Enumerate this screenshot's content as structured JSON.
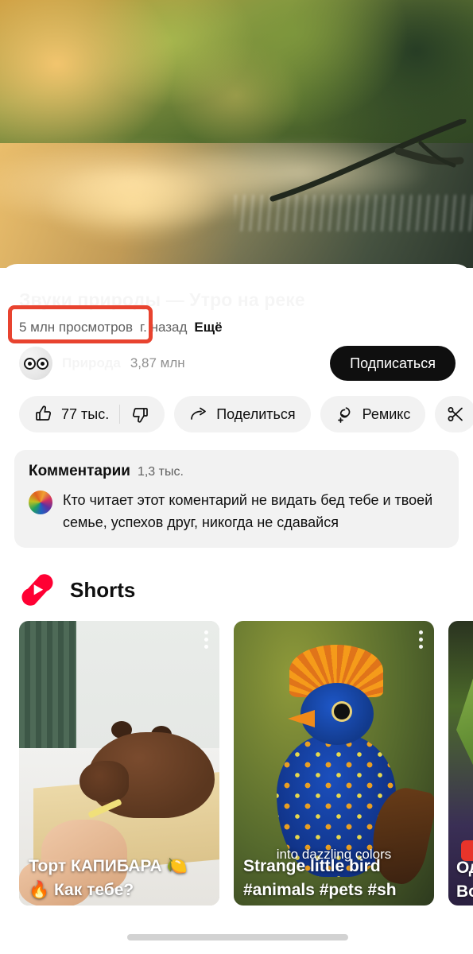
{
  "player": {
    "scene_description": "misty-river-forest-sunrise",
    "alt": "Туманная река на рассвете среди деревьев"
  },
  "video": {
    "title": "Звуки природы — Утро на реке",
    "views": "5 млн просмотров",
    "age": "г. назад",
    "more_label": "Ещё"
  },
  "annotation": {
    "target": "views-count",
    "color": "#e8432f"
  },
  "channel": {
    "avatar_icon": "googly-eyes-avatar",
    "name": "Природа",
    "subscribers": "3,87 млн",
    "subscribe_label": "Подписаться"
  },
  "actions": [
    {
      "name": "like",
      "icon": "thumbs-up-icon",
      "label": "77 тыс."
    },
    {
      "name": "dislike",
      "icon": "thumbs-down-icon",
      "label": ""
    },
    {
      "name": "share",
      "icon": "share-arrow-icon",
      "label": "Поделиться"
    },
    {
      "name": "remix",
      "icon": "remix-icon",
      "label": "Ремикс"
    },
    {
      "name": "clip",
      "icon": "scissors-icon",
      "label": ""
    }
  ],
  "comments": {
    "title": "Комментарии",
    "count": "1,3 тыс.",
    "top_comment": {
      "avatar_icon": "colorful-avatar",
      "text": "Кто читает этот коментарий не видать бед тебе и твоей семье, успехов друг, никогда не сдавайся"
    }
  },
  "shorts": {
    "logo_icon": "shorts-logo-icon",
    "heading": "Shorts",
    "items": [
      {
        "name": "capybara-cake",
        "title": "Торт КАПИБАРА 🍋",
        "title_line2": "🔥 Как тебе?",
        "caption": "",
        "menu_icon": "three-dot-menu-icon"
      },
      {
        "name": "strange-little-bird",
        "title": "Strange little bird",
        "title_line2": "#animals #pets #sh",
        "caption": "into dazzling colors",
        "menu_icon": "three-dot-menu-icon"
      },
      {
        "name": "third-short-partial",
        "title": "Од",
        "title_line2": "Во",
        "caption": "",
        "menu_icon": "three-dot-menu-icon"
      }
    ]
  },
  "scroll": {
    "indicator": "horizontal-scroll-indicator"
  },
  "colors": {
    "accent": "#e8342a",
    "annotation": "#e8432f",
    "chip_bg": "#f2f2f2",
    "text_primary": "#0f0f0f",
    "text_secondary": "#606060",
    "subscribe_bg": "#0f0f0f"
  }
}
